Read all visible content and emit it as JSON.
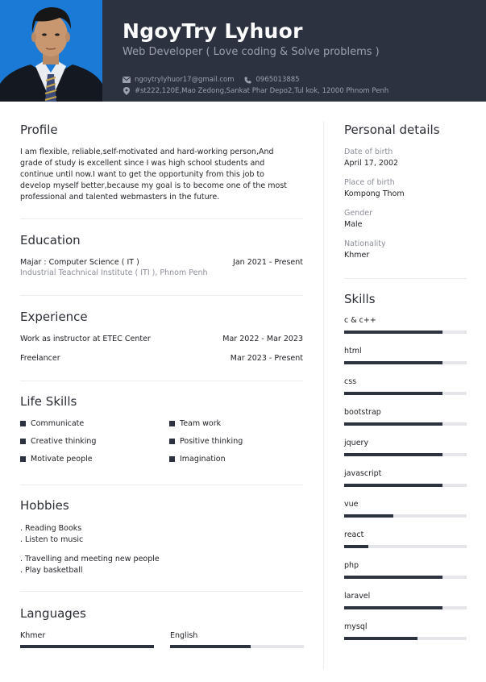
{
  "header": {
    "name": "NgoyTry Lyhuor",
    "role": "Web Developer ( Love coding & Solve problems )",
    "email": "ngoytrylyhuor17@gmail.com",
    "phone": "0965013885",
    "address": "#st222,120E,Mao Zedong,Sankat Phar Depo2,Tul kok, 12000 Phnom Penh",
    "accent_color": "#2d3240",
    "photo_bg": "#1b7ad6"
  },
  "profile": {
    "title": "Profile",
    "text": "I am flexible, reliable,self-motivated and hard-working person,And grade of study is excellent since I was high school students and continue until now.I want to get the opportunity from this job to develop myself better,because my goal is to become one of the most professional and talented webmasters in the future."
  },
  "education": {
    "title": "Education",
    "items": [
      {
        "degree": "Majar : Computer Science ( IT )",
        "dates": "Jan 2021 - Present",
        "school": "Industrial Teachnical Institute ( ITI ), Phnom Penh"
      }
    ]
  },
  "experience": {
    "title": "Experience",
    "items": [
      {
        "role": "Work as instructor at ETEC Center",
        "dates": "Mar 2022 - Mar 2023"
      },
      {
        "role": "Freelancer",
        "dates": "Mar 2023 - Present"
      }
    ]
  },
  "life_skills": {
    "title": "Life Skills",
    "items": [
      "Communicate",
      "Team work",
      "Creative thinking",
      "Positive thinking",
      "Motivate people",
      "Imagination"
    ]
  },
  "hobbies": {
    "title": "Hobbies",
    "items": [
      ". Reading Books",
      ". Listen to music",
      ". Travelling and meeting new people",
      ". Play basketball"
    ]
  },
  "languages": {
    "title": "Languages",
    "items": [
      {
        "name": "Khmer",
        "level": 1.0
      },
      {
        "name": "English",
        "level": 0.6
      }
    ]
  },
  "personal_details": {
    "title": "Personal details",
    "items": [
      {
        "label": "Date of birth",
        "value": "April 17, 2002"
      },
      {
        "label": "Place of birth",
        "value": "Kompong Thom"
      },
      {
        "label": "Gender",
        "value": "Male"
      },
      {
        "label": "Nationality",
        "value": "Khmer"
      }
    ]
  },
  "skills": {
    "title": "Skills",
    "items": [
      {
        "name": "c & c++",
        "level": 0.8
      },
      {
        "name": "html",
        "level": 0.8
      },
      {
        "name": "css",
        "level": 0.8
      },
      {
        "name": "bootstrap",
        "level": 0.8
      },
      {
        "name": "jquery",
        "level": 0.8
      },
      {
        "name": "javascript",
        "level": 0.8
      },
      {
        "name": "vue",
        "level": 0.4
      },
      {
        "name": "react",
        "level": 0.2
      },
      {
        "name": "php",
        "level": 0.8
      },
      {
        "name": "laravel",
        "level": 0.8
      },
      {
        "name": "mysql",
        "level": 0.6
      }
    ]
  }
}
